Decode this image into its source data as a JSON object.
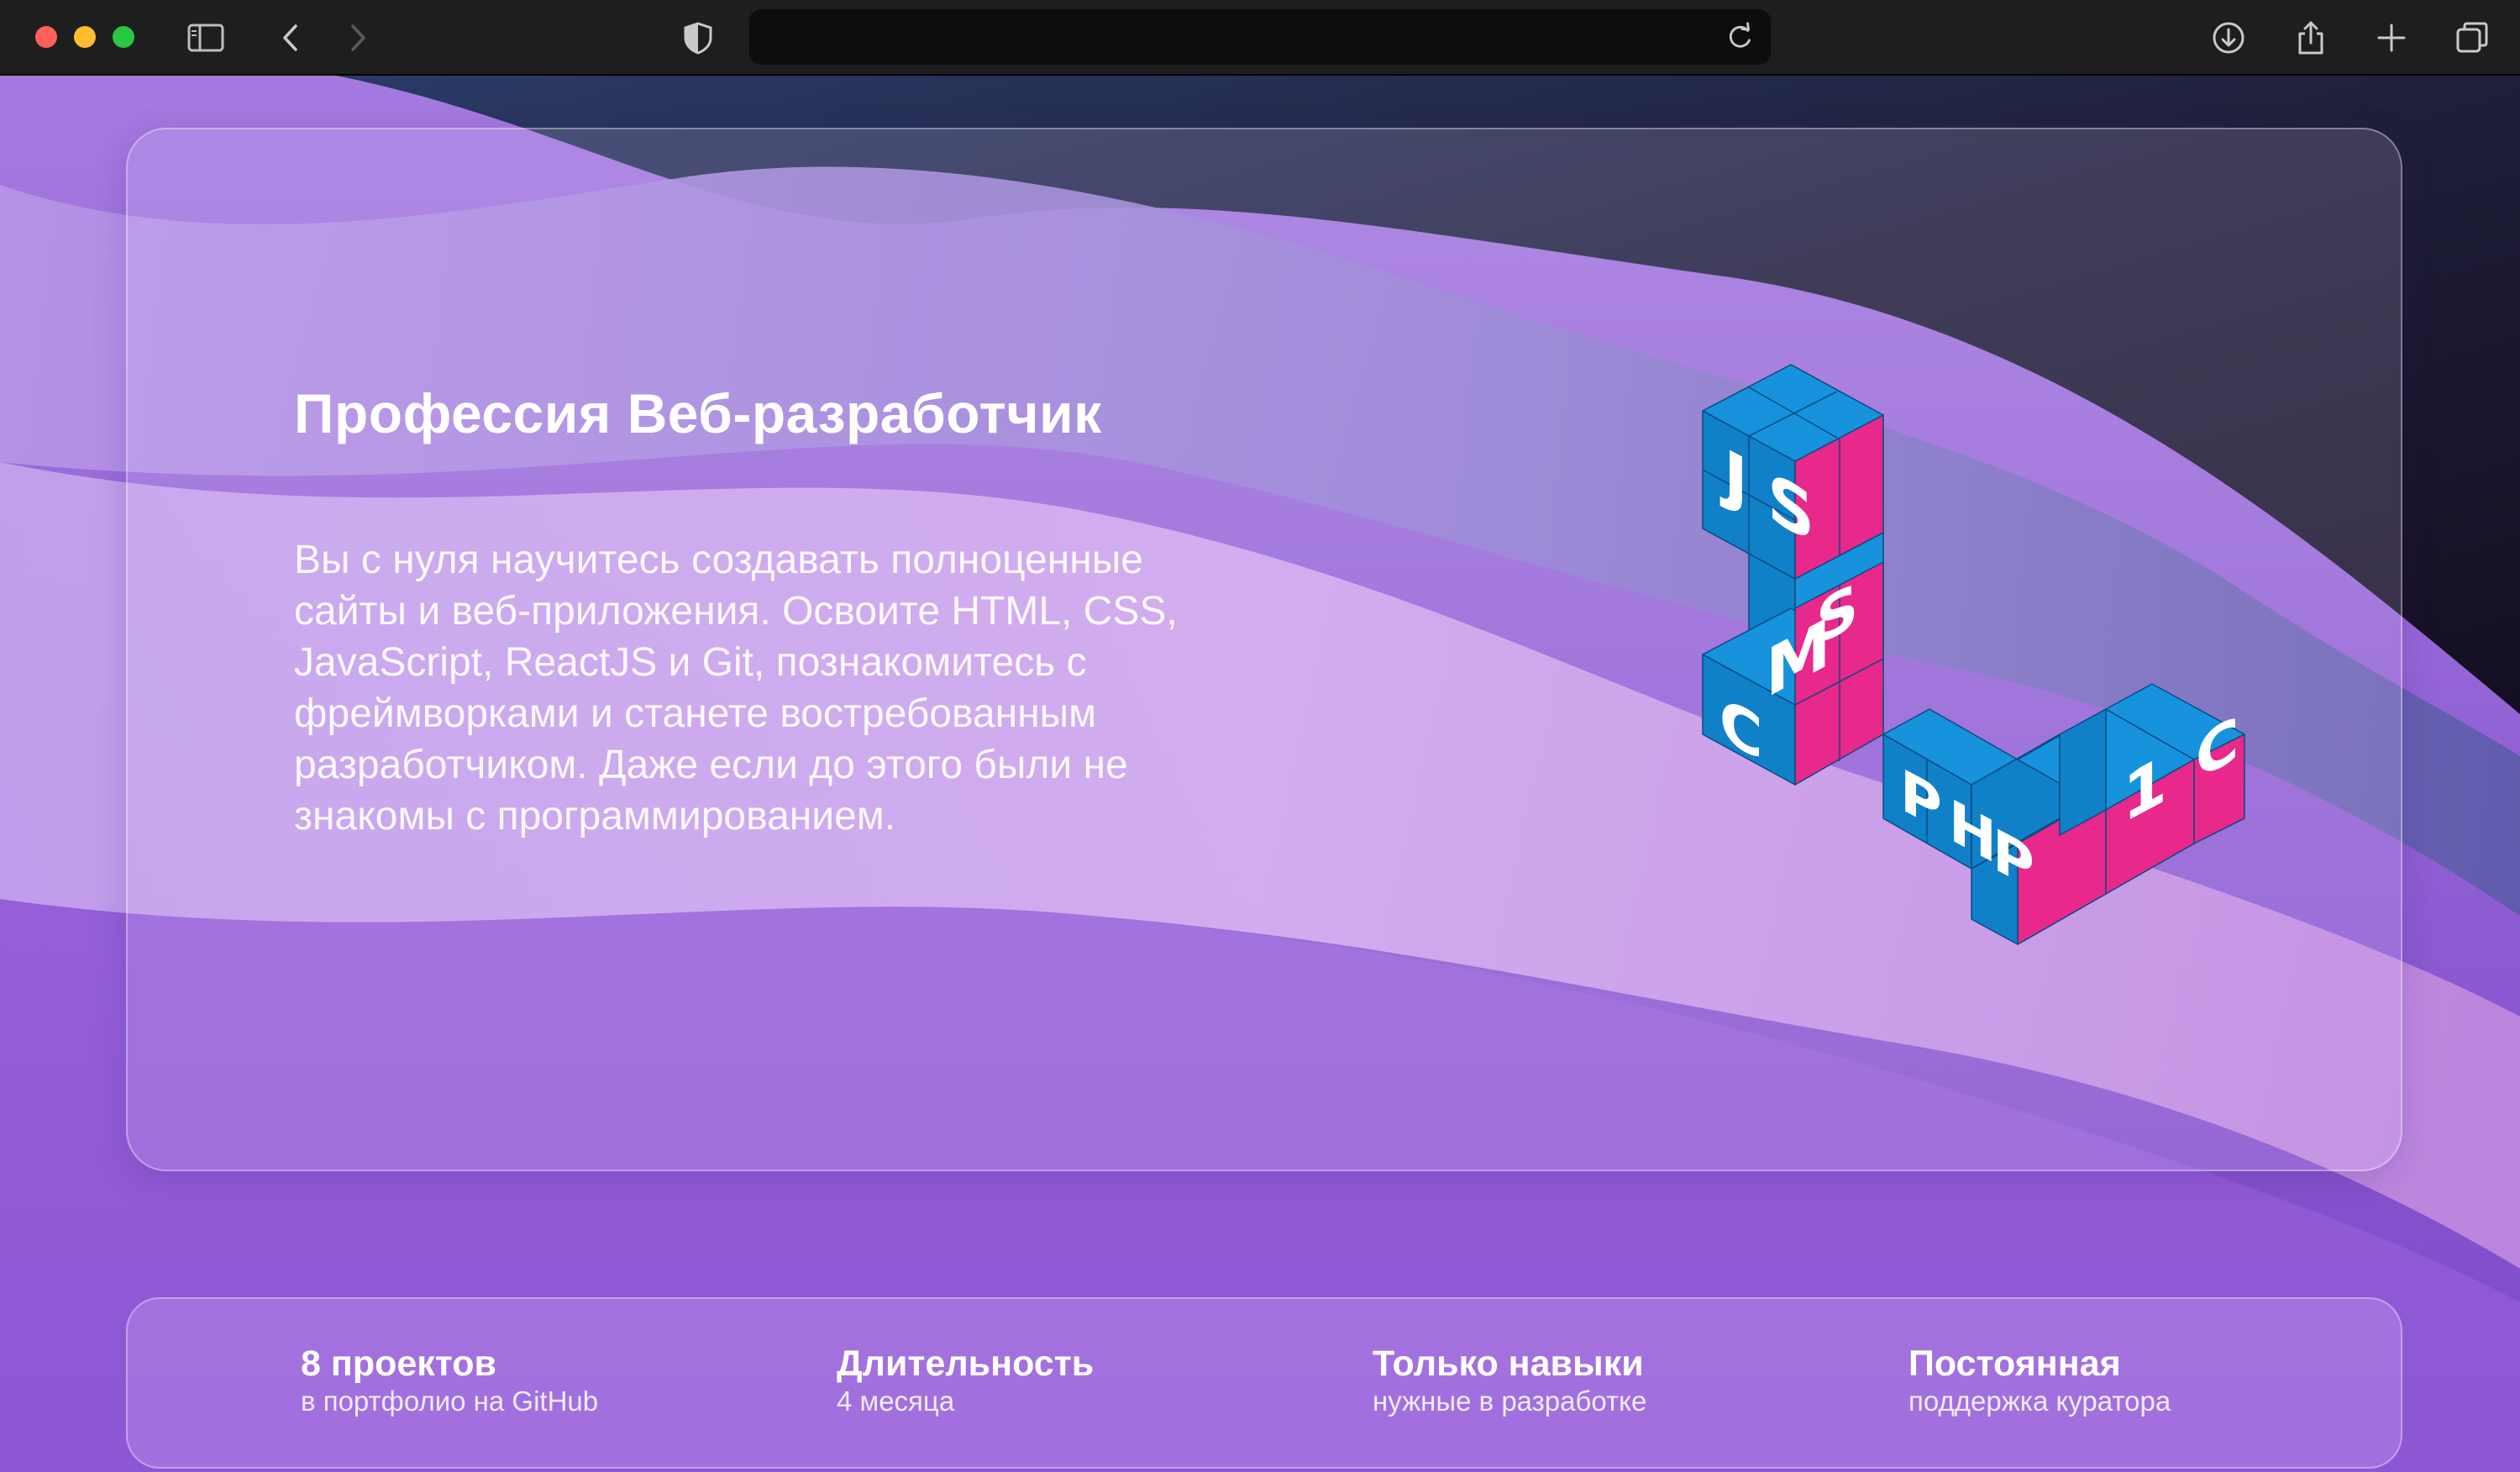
{
  "browser": {
    "toolbar_icons": [
      "sidebar-icon",
      "back-icon",
      "forward-icon",
      "shield-icon",
      "reload-icon",
      "download-icon",
      "share-icon",
      "new-tab-icon",
      "tab-overview-icon"
    ],
    "address": ""
  },
  "hero": {
    "title": "Профессия Веб-разработчик",
    "description": "Вы с нуля научитесь создавать полноценные сайты и веб-приложения. Освоите HTML, CSS, JavaScript, ReactJS и Git, познакомитесь с фреймворками и станете востребованным разработчиком. Даже если до этого были не знакомы с программированием.",
    "illustration": {
      "cube_letters": [
        "J",
        "S",
        "C",
        "M",
        "S",
        "P",
        "H",
        "P",
        "1",
        "C"
      ],
      "colors": {
        "blue": "#0a8ad4",
        "pink": "#e8288a"
      }
    }
  },
  "stats": [
    {
      "title": "8 проектов",
      "subtitle": "в портфолио на GitHub"
    },
    {
      "title": "Длительность",
      "subtitle": "4 месяца"
    },
    {
      "title": "Только навыки",
      "subtitle": "нужные в разработке"
    },
    {
      "title": "Постоянная",
      "subtitle": "поддержка куратора"
    }
  ],
  "colors": {
    "toolbar": "#1e1e1f",
    "background_purple": "#a77be0",
    "cube_blue": "#0a8ad4",
    "cube_pink": "#e8288a"
  }
}
